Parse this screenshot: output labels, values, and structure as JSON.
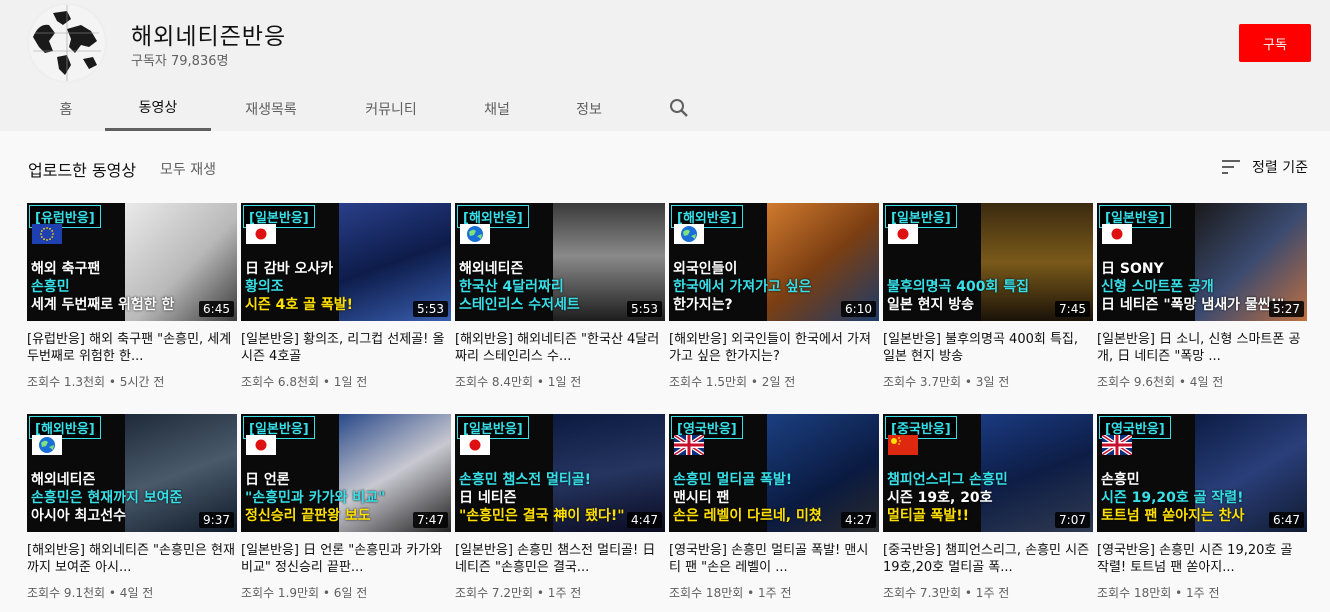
{
  "channel": {
    "name": "해외네티즌반응",
    "subscribers": "구독자 79,836명",
    "subscribe_label": "구독"
  },
  "tabs": [
    {
      "label": "홈"
    },
    {
      "label": "동영상",
      "active": true
    },
    {
      "label": "재생목록"
    },
    {
      "label": "커뮤니티"
    },
    {
      "label": "채널"
    },
    {
      "label": "정보"
    }
  ],
  "section": {
    "title": "업로드한 동영상",
    "play_all": "모두 재생",
    "sort_label": "정렬 기준"
  },
  "videos": [
    {
      "tag": "[유럽반응]",
      "flag": "eu",
      "caption": [
        {
          "t": "해외 축구팬",
          "c": "#ffffff"
        },
        {
          "t": "손흥민",
          "c": "#37e0e8"
        },
        {
          "t": "세계 두번째로 위험한 한",
          "c": "#ffffff"
        }
      ],
      "duration": "6:45",
      "title": "[유럽반응] 해외 축구팬 \"손흥민, 세계 두번째로 위험한 한...",
      "meta": "조회수 1.3천회 • 5시간 전"
    },
    {
      "tag": "[일본반응]",
      "flag": "jp",
      "caption": [
        {
          "t": "日 감바 오사카",
          "c": "#ffffff"
        },
        {
          "t": "황의조",
          "c": "#37e0e8"
        },
        {
          "t": "시즌 4호 골 폭발!",
          "c": "#ffe000"
        }
      ],
      "duration": "5:53",
      "title": "[일본반응] 황의조, 리그컵 선제골! 올 시즌 4호골",
      "meta": "조회수 6.8천회 • 1일 전"
    },
    {
      "tag": "[해외반응]",
      "flag": "globe",
      "caption": [
        {
          "t": "해외네티즌",
          "c": "#ffffff"
        },
        {
          "t": "한국산 4달러짜리",
          "c": "#37e0e8"
        },
        {
          "t": "스테인리스 수저세트",
          "c": "#37e0e8"
        }
      ],
      "duration": "5:53",
      "title": "[해외반응] 해외네티즌 \"한국산 4달러짜리 스테인리스 수...",
      "meta": "조회수 8.4만회 • 1일 전"
    },
    {
      "tag": "[해외반응]",
      "flag": "globe",
      "caption": [
        {
          "t": "외국인들이",
          "c": "#ffffff"
        },
        {
          "t": "한국에서 가져가고 싶은",
          "c": "#37e0e8"
        },
        {
          "t": "한가지는?",
          "c": "#ffffff"
        }
      ],
      "duration": "6:10",
      "title": "[해외반응] 외국인들이 한국에서 가져가고 싶은 한가지는?",
      "meta": "조회수 1.5만회 • 2일 전"
    },
    {
      "tag": "[일본반응]",
      "flag": "jp",
      "caption": [
        {
          "t": "불후의명곡 400회 특집",
          "c": "#37e0e8"
        },
        {
          "t": "일본 현지 방송",
          "c": "#ffffff"
        }
      ],
      "duration": "7:45",
      "title": "[일본반응] 불후의명곡 400회 특집, 일본 현지 방송",
      "meta": "조회수 3.7만회 • 3일 전"
    },
    {
      "tag": "[일본반응]",
      "flag": "jp",
      "caption": [
        {
          "t": "日 SONY",
          "c": "#ffffff"
        },
        {
          "t": "신형 스마트폰 공개",
          "c": "#37e0e8"
        },
        {
          "t": "日 네티즌 \"폭망 냄새가 물씬!\"",
          "c": "#ffffff"
        }
      ],
      "duration": "5:27",
      "title": "[일본반응] 日 소니, 신형 스마트폰 공개, 日 네티즌 \"폭망 ...",
      "meta": "조회수 9.6천회 • 4일 전"
    },
    {
      "tag": "[해외반응]",
      "flag": "globe",
      "caption": [
        {
          "t": "해외네티즌",
          "c": "#ffffff"
        },
        {
          "t": "손흥민은 현재까지 보여준",
          "c": "#37e0e8"
        },
        {
          "t": "아시아 최고선수",
          "c": "#ffffff"
        }
      ],
      "duration": "9:37",
      "title": "[해외반응] 해외네티즌 \"손흥민은 현재까지 보여준 아시...",
      "meta": "조회수 9.1천회 • 4일 전"
    },
    {
      "tag": "[일본반응]",
      "flag": "jp",
      "caption": [
        {
          "t": "日 언론",
          "c": "#ffffff"
        },
        {
          "t": "\"손흥민과 카가와 비교\"",
          "c": "#37e0e8"
        },
        {
          "t": "정신승리 끝판왕 보도",
          "c": "#ffe000"
        }
      ],
      "duration": "7:47",
      "title": "[일본반응] 日 언론 \"손흥민과 카가와 비교\" 정신승리 끝판...",
      "meta": "조회수 1.9만회 • 6일 전"
    },
    {
      "tag": "[일본반응]",
      "flag": "jp",
      "caption": [
        {
          "t": "손흥민 챔스전 멀티골!",
          "c": "#37e0e8"
        },
        {
          "t": "日 네티즌",
          "c": "#ffffff"
        },
        {
          "t": "\"손흥민은 결국 神이 됐다!\"",
          "c": "#ffe000"
        }
      ],
      "duration": "4:47",
      "title": "[일본반응] 손흥민 챔스전 멀티골! 日 네티즌 \"손흥민은 결국...",
      "meta": "조회수 7.2만회 • 1주 전"
    },
    {
      "tag": "[영국반응]",
      "flag": "uk",
      "caption": [
        {
          "t": "손흥민 멀티골 폭발!",
          "c": "#37e0e8"
        },
        {
          "t": "맨시티 팬",
          "c": "#ffffff"
        },
        {
          "t": "손은 레벨이 다르네, 미쳤",
          "c": "#ffe000"
        }
      ],
      "duration": "4:27",
      "title": "[영국반응] 손흥민 멀티골 폭발! 맨시티 팬 \"손은 레벨이 ...",
      "meta": "조회수 18만회 • 1주 전"
    },
    {
      "tag": "[중국반응]",
      "flag": "cn",
      "caption": [
        {
          "t": "챔피언스리그 손흥민",
          "c": "#37e0e8"
        },
        {
          "t": "시즌 19호, 20호",
          "c": "#ffffff"
        },
        {
          "t": "멀티골 폭발!!",
          "c": "#ffe000"
        }
      ],
      "duration": "7:07",
      "title": "[중국반응] 챔피언스리그, 손흥민 시즌 19호,20호 멀티골 폭...",
      "meta": "조회수 7.3만회 • 1주 전"
    },
    {
      "tag": "[영국반응]",
      "flag": "uk",
      "caption": [
        {
          "t": "손흥민",
          "c": "#ffffff"
        },
        {
          "t": "시즌 19,20호 골 작렬!",
          "c": "#37e0e8"
        },
        {
          "t": "토트넘 팬 쏟아지는 찬사",
          "c": "#ffe000"
        }
      ],
      "duration": "6:47",
      "title": "[영국반응] 손흥민 시즌 19,20호 골 작렬! 토트넘 팬 쏟아지...",
      "meta": "조회수 18만회 • 1주 전"
    }
  ]
}
